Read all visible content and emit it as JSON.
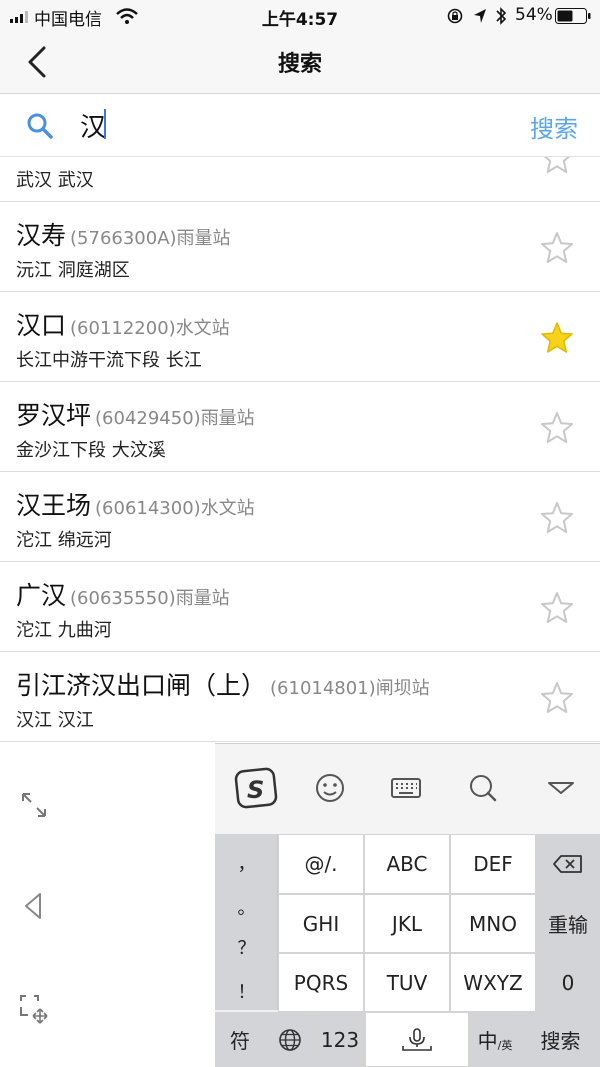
{
  "status_bar": {
    "carrier": "中国电信",
    "time": "上午4:57",
    "battery": "54%"
  },
  "nav": {
    "title": "搜索",
    "back_icon": "chevron-left-icon"
  },
  "search": {
    "query": "汉",
    "button_label": "搜索"
  },
  "results": [
    {
      "name": "",
      "code": "",
      "type": "",
      "sub": "武汉 武汉",
      "starred": false
    },
    {
      "name": "汉寿",
      "code": "(5766300A)",
      "type": "雨量站",
      "sub": "沅江 洞庭湖区",
      "starred": false
    },
    {
      "name": "汉口",
      "code": "(60112200)",
      "type": "水文站",
      "sub": "长江中游干流下段 长江",
      "starred": true
    },
    {
      "name": "罗汉坪",
      "code": "(60429450)",
      "type": "雨量站",
      "sub": "金沙江下段 大汶溪",
      "starred": false
    },
    {
      "name": "汉王场",
      "code": "(60614300)",
      "type": "水文站",
      "sub": "沱江 绵远河",
      "starred": false
    },
    {
      "name": "广汉",
      "code": "(60635550)",
      "type": "雨量站",
      "sub": "沱江 九曲河",
      "starred": false
    },
    {
      "name": "引江济汉出口闸（上）",
      "code": "(61014801)",
      "type": "闸坝站",
      "sub": "汉江 汉江",
      "starred": false
    }
  ],
  "colors": {
    "star_on": "#f7d21a",
    "star_off": "#c8c8c8",
    "accent": "#5aa6e8"
  },
  "keyboard": {
    "toolbar_icons": [
      "sogou-logo-icon",
      "emoji-icon",
      "keyboard-icon",
      "search-icon",
      "collapse-icon"
    ],
    "punctuation": [
      "，",
      "。",
      "？",
      "！"
    ],
    "keys": {
      "k1": "@/.",
      "k2": "ABC",
      "k3": "DEF",
      "k4": "GHI",
      "k5": "JKL",
      "k6": "MNO",
      "k7": "PQRS",
      "k8": "TUV",
      "k9": "WXYZ",
      "reenter": "重输",
      "zero": "0",
      "symbol": "符",
      "num": "123",
      "lang_main": "中",
      "lang_sub": "/英",
      "search": "搜索"
    }
  }
}
